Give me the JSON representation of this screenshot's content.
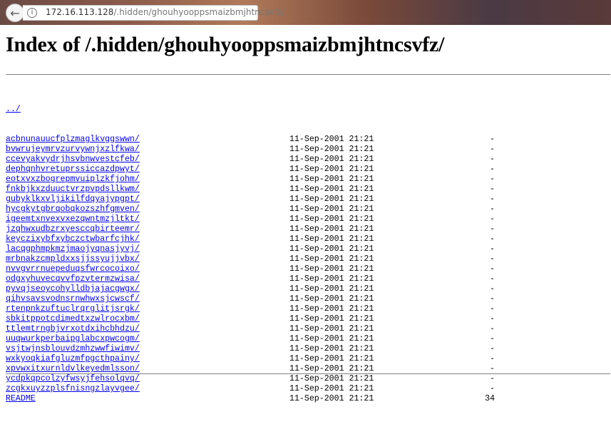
{
  "browser": {
    "url_host": "172.16.113.128",
    "url_path": "/.hidden/ghouhyooppsmaizbmjhtncsvfz/"
  },
  "page": {
    "title": "Index of /.hidden/ghouhyooppsmaizbmjhtncsvfz/",
    "parent_link": "../",
    "entries": [
      {
        "name": "acbnunauucfplzmaglkvggswwn/",
        "date": "11-Sep-2001 21:21",
        "size": "-"
      },
      {
        "name": "bvwrujeymrvzurvywnjxzlfkwa/",
        "date": "11-Sep-2001 21:21",
        "size": "-"
      },
      {
        "name": "ccevyakvydrjhsvbnwvestcfeb/",
        "date": "11-Sep-2001 21:21",
        "size": "-"
      },
      {
        "name": "dephqnhvretuprssiccazdpwyt/",
        "date": "11-Sep-2001 21:21",
        "size": "-"
      },
      {
        "name": "eotxvxzbogrepmvuiplzkfjohm/",
        "date": "11-Sep-2001 21:21",
        "size": "-"
      },
      {
        "name": "fnkbjkxzduuctvrzpvpdsllkwm/",
        "date": "11-Sep-2001 21:21",
        "size": "-"
      },
      {
        "name": "gubyklkxvljikilfdqyajypgpt/",
        "date": "11-Sep-2001 21:21",
        "size": "-"
      },
      {
        "name": "hycgkytgbrqobqkozszhfgmven/",
        "date": "11-Sep-2001 21:21",
        "size": "-"
      },
      {
        "name": "igeemtxnvexvxezqwntmzjltkt/",
        "date": "11-Sep-2001 21:21",
        "size": "-"
      },
      {
        "name": "jzqhwxudbzrxyesccqbirteemr/",
        "date": "11-Sep-2001 21:21",
        "size": "-"
      },
      {
        "name": "keyczixybfxybczctwbarfcjhk/",
        "date": "11-Sep-2001 21:21",
        "size": "-"
      },
      {
        "name": "lacqgphmpkmzjmaojyqnasjyvj/",
        "date": "11-Sep-2001 21:21",
        "size": "-"
      },
      {
        "name": "mrbnakzcmpldxxsjjssyujjvbx/",
        "date": "11-Sep-2001 21:21",
        "size": "-"
      },
      {
        "name": "nvvgvrrnuepeduqsfwrcocoixo/",
        "date": "11-Sep-2001 21:21",
        "size": "-"
      },
      {
        "name": "odgxyhuvecqvvfpzvtermzwisa/",
        "date": "11-Sep-2001 21:21",
        "size": "-"
      },
      {
        "name": "pyvqjseoycohylldbjajacgwgx/",
        "date": "11-Sep-2001 21:21",
        "size": "-"
      },
      {
        "name": "qihvsavsvodnsrnwhwxsjcwscf/",
        "date": "11-Sep-2001 21:21",
        "size": "-"
      },
      {
        "name": "rtenpnkzuftuclrqrglitjsrgk/",
        "date": "11-Sep-2001 21:21",
        "size": "-"
      },
      {
        "name": "sbkitppotcdimedtxzwlrocxbm/",
        "date": "11-Sep-2001 21:21",
        "size": "-"
      },
      {
        "name": "ttlemtrngbjvrxotdxihcbhdzu/",
        "date": "11-Sep-2001 21:21",
        "size": "-"
      },
      {
        "name": "uuqwurkperbaipglabcxpwcogm/",
        "date": "11-Sep-2001 21:21",
        "size": "-"
      },
      {
        "name": "vsjtwjnsblouvdzmhzwwfiwimv/",
        "date": "11-Sep-2001 21:21",
        "size": "-"
      },
      {
        "name": "wxkyoqkiafgluzmfpgcthpainy/",
        "date": "11-Sep-2001 21:21",
        "size": "-"
      },
      {
        "name": "xpvwxitxurnldvlkeyedmlsson/",
        "date": "11-Sep-2001 21:21",
        "size": "-"
      },
      {
        "name": "ycdpkqpcolzyfwsyjfehsolqvq/",
        "date": "11-Sep-2001 21:21",
        "size": "-"
      },
      {
        "name": "zcgkxuyzzplsfnisngzlayvgee/",
        "date": "11-Sep-2001 21:21",
        "size": "-"
      },
      {
        "name": "README",
        "date": "11-Sep-2001 21:21",
        "size": "34"
      }
    ]
  },
  "icons": {
    "back": "back-arrow-icon",
    "info": "info-icon"
  },
  "colors": {
    "link": "#0000ee",
    "rule": "#808080"
  }
}
